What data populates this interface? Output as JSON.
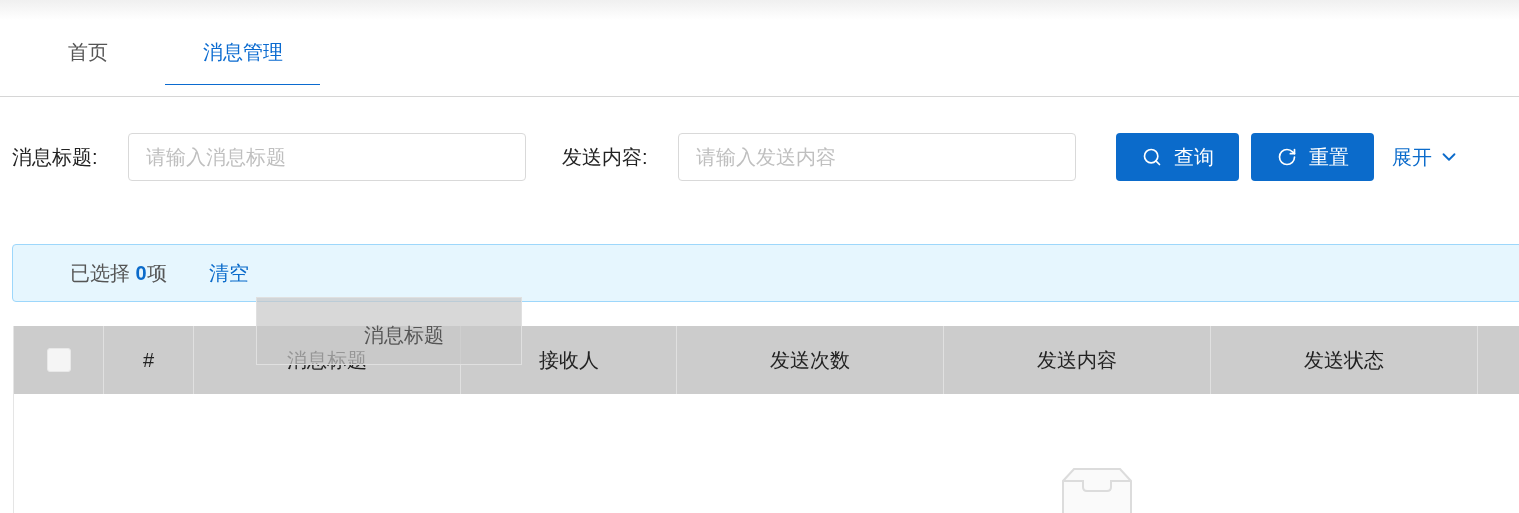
{
  "tabs": [
    {
      "label": "首页",
      "selected": false
    },
    {
      "label": "消息管理",
      "selected": true
    }
  ],
  "filters": [
    {
      "label": "消息标题:",
      "placeholder": "请输入消息标题"
    },
    {
      "label": "发送内容:",
      "placeholder": "请输入发送内容"
    }
  ],
  "buttons": [
    {
      "kind": "search",
      "label": "查询"
    },
    {
      "kind": "reset",
      "label": "重置"
    }
  ],
  "expand_link": "展开",
  "selection_alert": {
    "prefix": "已选择 ",
    "count": "0",
    "suffix": "项",
    "clear": "清空"
  },
  "table": {
    "select_all": {
      "checked": false
    },
    "columns": [
      "#",
      "消息标题",
      "接收人",
      "发送次数",
      "发送内容",
      "发送状态"
    ]
  },
  "drag_ghost": "消息标题"
}
